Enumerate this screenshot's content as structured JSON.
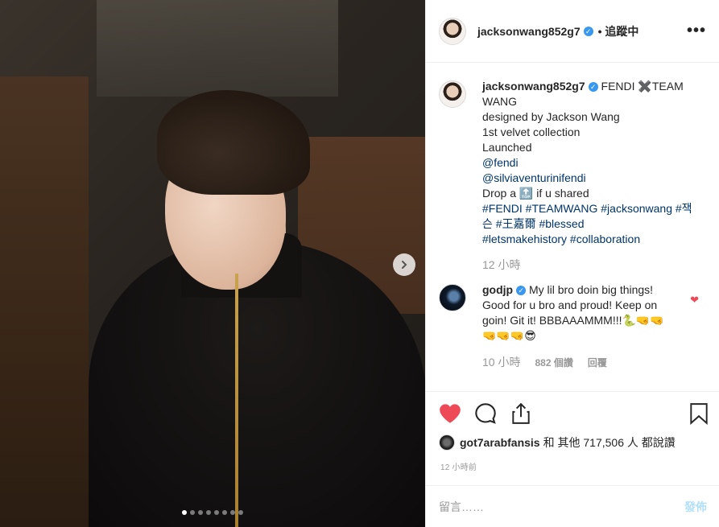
{
  "header": {
    "username": "jacksonwang852g7",
    "follow_label": "• 追蹤中",
    "more_label": "•••"
  },
  "caption": {
    "username": "jacksonwang852g7",
    "line1": "FENDI ✖️TEAM WANG",
    "line2": "designed by Jackson Wang",
    "line3": "1st velvet collection",
    "line4": "Launched",
    "mention1": "@fendi",
    "mention2": "@silviaventurinifendi",
    "line5_prefix": "Drop a 🔝 if u shared",
    "hashtags1": "#FENDI #TEAMWANG #jacksonwang #잭슨 #王嘉爾 #blessed",
    "hashtags2": "#letsmakehistory #collaboration",
    "time": "12 小時"
  },
  "reply": {
    "username": "godjp",
    "text": "My lil bro doin big things! Good for u bro and proud! Keep on goin! Git it! BBBAAAMMM!!!🐍🤜🤜🤜🤜🤜😎",
    "time": "10 小時",
    "likes": "882 個讚",
    "reply_label": "回覆"
  },
  "likes": {
    "user": "got7arabfansis",
    "rest": "和 其他 717,506 人 都說讚"
  },
  "post_time": "12 小時前",
  "comment": {
    "placeholder": "留言……",
    "post_label": "發佈"
  },
  "carousel": {
    "total": 8,
    "active": 0
  },
  "colors": {
    "like_red": "#ed4956",
    "link": "#003569",
    "verified": "#3897f0",
    "post_disabled": "#b2dffc"
  }
}
